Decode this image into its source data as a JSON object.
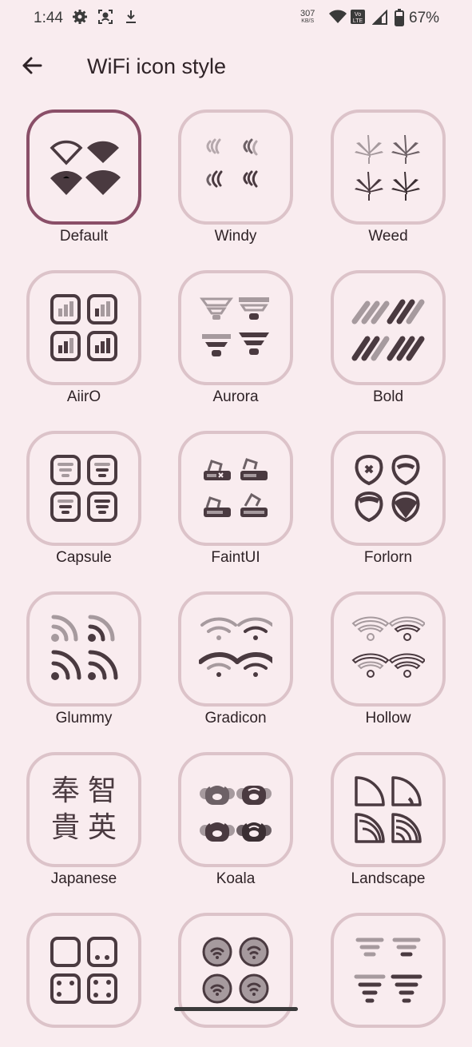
{
  "status_bar": {
    "time": "1:44",
    "speed_value": "307",
    "speed_unit": "KB/S",
    "battery": "67%",
    "icons": [
      "settings-gear-icon",
      "screenshot-icon",
      "download-icon",
      "wifi-icon",
      "volte-icon",
      "signal-icon",
      "battery-icon"
    ]
  },
  "app_bar": {
    "title": "WiFi icon style",
    "back_icon": "arrow-left-icon"
  },
  "styles": [
    {
      "label": "Default",
      "selected": true
    },
    {
      "label": "Windy"
    },
    {
      "label": "Weed"
    },
    {
      "label": "AiirO"
    },
    {
      "label": "Aurora"
    },
    {
      "label": "Bold"
    },
    {
      "label": "Capsule"
    },
    {
      "label": "FaintUI"
    },
    {
      "label": "Forlorn"
    },
    {
      "label": "Glummy"
    },
    {
      "label": "Gradicon"
    },
    {
      "label": "Hollow"
    },
    {
      "label": "Japanese",
      "glyphs": [
        "奉",
        "智",
        "貴",
        "英"
      ]
    },
    {
      "label": "Koala"
    },
    {
      "label": "Landscape"
    },
    {
      "label": ""
    },
    {
      "label": ""
    },
    {
      "label": ""
    }
  ],
  "colors": {
    "background": "#f9ecef",
    "tile_border": "#dcc3c9",
    "selected_border": "#8a4f68",
    "icon": "#4a3a40"
  }
}
